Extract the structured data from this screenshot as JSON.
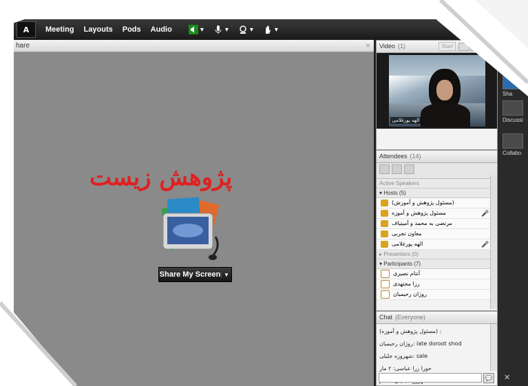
{
  "topbar": {
    "logo": "A",
    "menu": [
      "Meeting",
      "Layouts",
      "Pods",
      "Audio"
    ]
  },
  "share_pod": {
    "title": "hare",
    "overlay_text": "پژوهش زیست",
    "button_label": "Share My Screen"
  },
  "video_pod": {
    "title": "Video",
    "count": "(1)",
    "start_label": "Start",
    "name_tag": "الهه پورغلامی"
  },
  "attendees_pod": {
    "title": "Attendees",
    "count": "(14)",
    "active_speakers": "Active Speakers",
    "hosts_label": "Hosts (5)",
    "hosts": [
      "(مسئول پژوهش و آموزش)",
      "مسئول پژوهش و آموزه",
      "مرتضی به محمد و آمیتیاف",
      "معاون تجربی",
      "الهه پورغلامی"
    ],
    "presenters_label": "Presenters (0)",
    "participants_label": "Participants (7)",
    "participants": [
      "آنتام نصیری",
      "رزا مجتهدی",
      "روژان رحیمیان"
    ]
  },
  "chat_pod": {
    "title": "Chat",
    "scope": "(Everyone)",
    "messages": [
      "(مسئول پژوهش و آموزه) :",
      "روژان رحیمیان: late doroot shod",
      "شهروزه جلیلی: sale",
      "حورا زرا عباسی: ۲ مار",
      "شهروزه جلیلی: سلام"
    ]
  },
  "far_right": {
    "items": [
      "Sha",
      "Discussi",
      "Collabo"
    ]
  }
}
